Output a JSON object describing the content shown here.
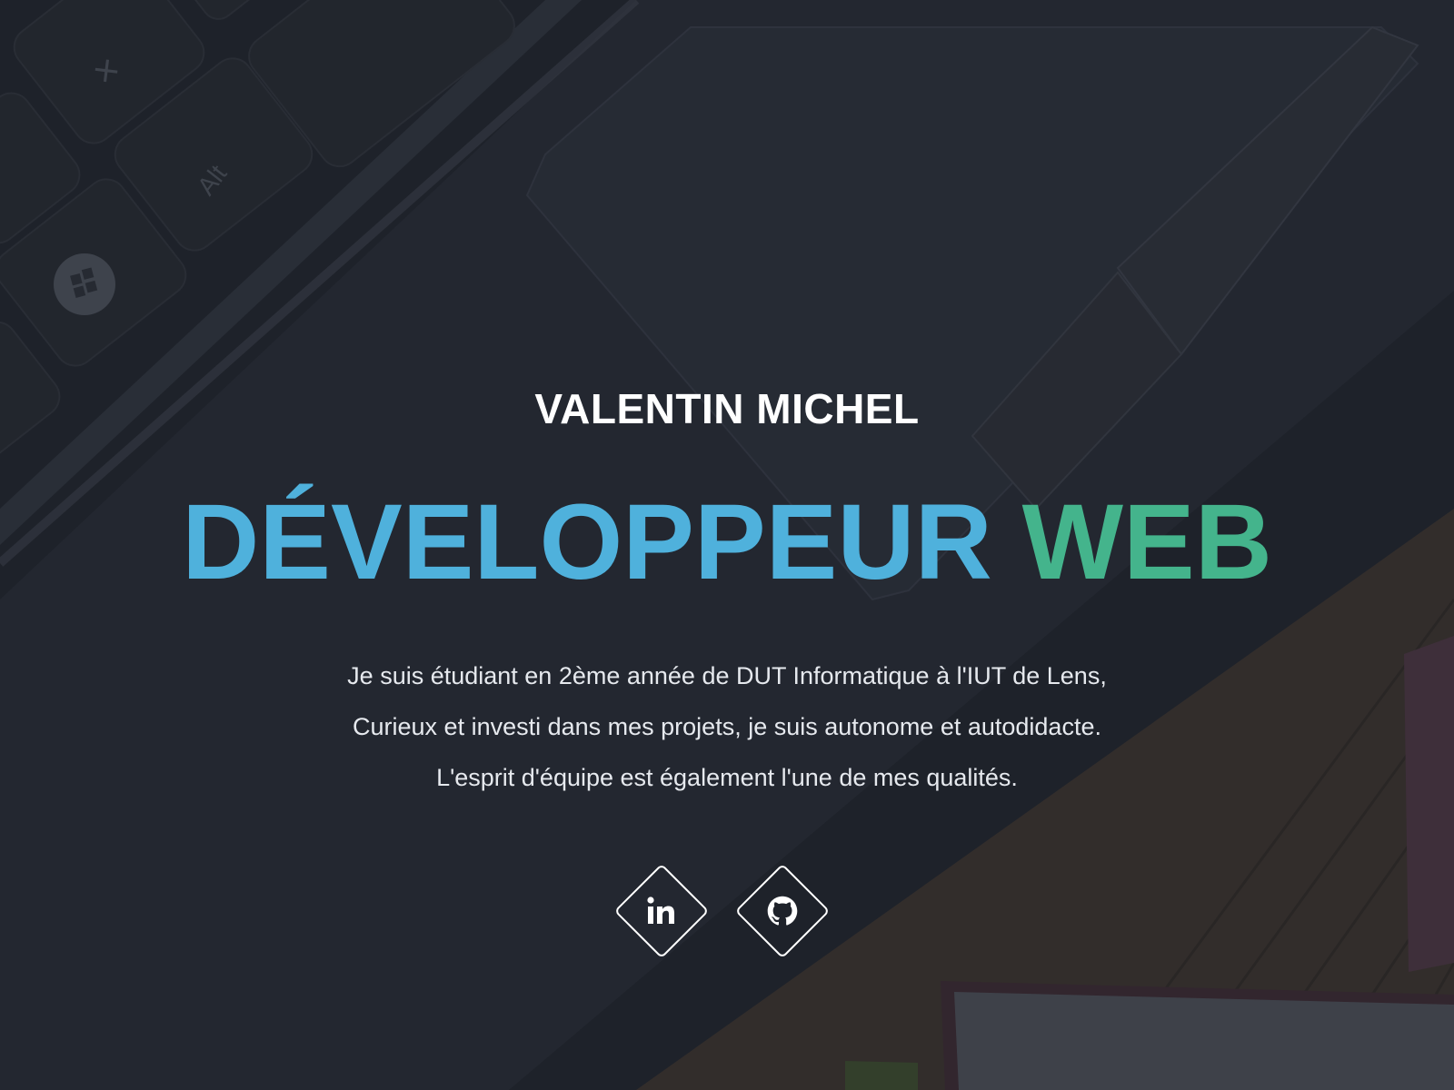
{
  "hero": {
    "name": "VALENTIN MICHEL",
    "headline_part1": "DÉVELOPPEUR",
    "headline_part2": "WEB",
    "bio_lines": [
      "Je suis étudiant en 2ème année de DUT Informatique à l'IUT de Lens,",
      "Curieux et investi dans mes projets, je suis autonome et autodidacte.",
      "L'esprit d'équipe est également l'une de mes qualités."
    ]
  },
  "socials": [
    {
      "icon": "linkedin-icon"
    },
    {
      "icon": "github-icon"
    }
  ],
  "colors": {
    "background": "#1f232b",
    "accent_blue": "#4fb1dc",
    "accent_green": "#44b48c",
    "text": "#ffffff"
  }
}
